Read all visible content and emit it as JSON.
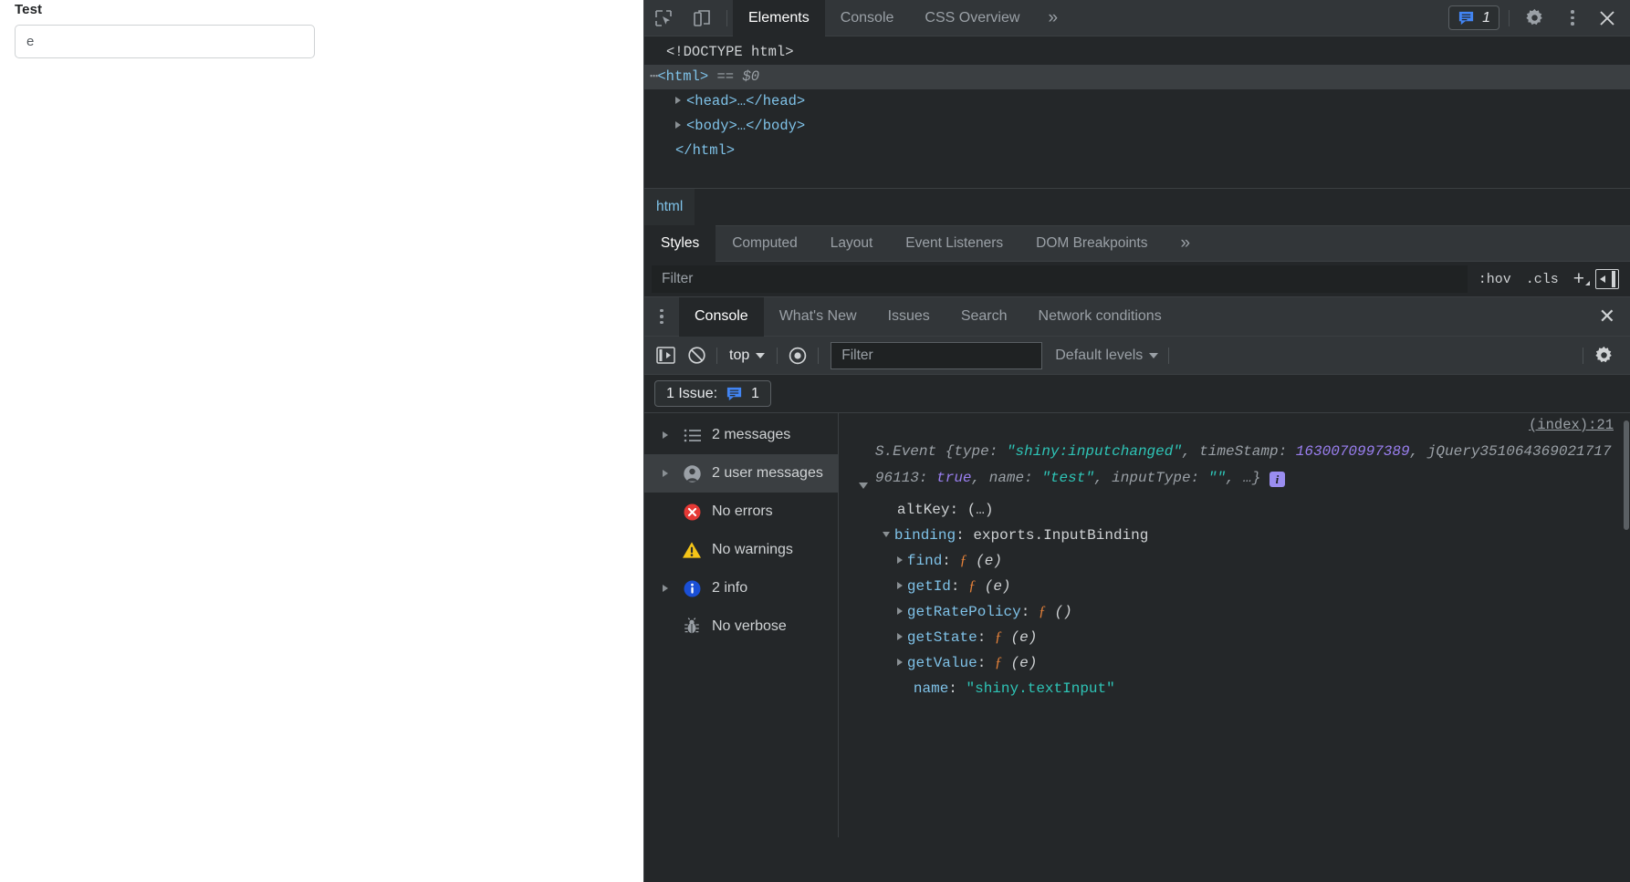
{
  "page": {
    "label": "Test",
    "input_value": "e",
    "input_placeholder": ""
  },
  "devtools": {
    "main_tabs": [
      {
        "label": "Elements",
        "active": true
      },
      {
        "label": "Console",
        "active": false
      },
      {
        "label": "CSS Overview",
        "active": false
      }
    ],
    "more_tabs_glyph": "»",
    "issue_count": "1",
    "icons": {
      "inspect": "inspect-element-icon",
      "device": "device-toolbar-icon",
      "issues": "issues-message-icon",
      "settings": "gear-icon",
      "menu": "kebab-menu-icon",
      "close": "close-icon"
    },
    "dom": {
      "doctype": "<!DOCTYPE html>",
      "html_open": "<html>",
      "eq": "==",
      "dollar0": "$0",
      "head": "<head>…</head>",
      "body": "<body>…</body>",
      "html_close": "</html>"
    },
    "breadcrumb": [
      "html"
    ],
    "styles_tabs": [
      {
        "label": "Styles",
        "active": true
      },
      {
        "label": "Computed",
        "active": false
      },
      {
        "label": "Layout",
        "active": false
      },
      {
        "label": "Event Listeners",
        "active": false
      },
      {
        "label": "DOM Breakpoints",
        "active": false
      }
    ],
    "styles_more_glyph": "»",
    "styles_filter_placeholder": "Filter",
    "styles_filter_value": "",
    "hov_label": ":hov",
    "cls_label": ".cls",
    "plus_label": "+"
  },
  "drawer": {
    "tabs": [
      {
        "label": "Console",
        "active": true
      },
      {
        "label": "What's New",
        "active": false
      },
      {
        "label": "Issues",
        "active": false
      },
      {
        "label": "Search",
        "active": false
      },
      {
        "label": "Network conditions",
        "active": false
      }
    ],
    "close_glyph": "✕",
    "toolbar": {
      "context_label": "top",
      "filter_placeholder": "Filter",
      "filter_value": "",
      "levels_label": "Default levels"
    },
    "issues_button": {
      "text": "1 Issue:",
      "count": "1"
    },
    "message_summary": [
      {
        "label": "2 messages",
        "icon": "list-icon",
        "expandable": true,
        "selected": false
      },
      {
        "label": "2 user messages",
        "icon": "user-icon",
        "expandable": true,
        "selected": true
      },
      {
        "label": "No errors",
        "icon": "error-icon",
        "expandable": false,
        "selected": false
      },
      {
        "label": "No warnings",
        "icon": "warning-icon",
        "expandable": false,
        "selected": false
      },
      {
        "label": "2 info",
        "icon": "info-icon",
        "expandable": true,
        "selected": false
      },
      {
        "label": "No verbose",
        "icon": "bug-icon",
        "expandable": false,
        "selected": false
      }
    ],
    "output": {
      "source_link": "(index):21",
      "event_header": {
        "class_name": "S.Event {",
        "k_type": "type: ",
        "v_type": "\"shiny:inputchanged\"",
        "sep1": ", ",
        "k_timestamp": "timeStamp: ",
        "v_timestamp": "1630070997389",
        "sep2": ", ",
        "k_jquery": "jQuery35106436902171796113: ",
        "v_jquery": "true",
        "sep3": ", ",
        "k_name": "name: ",
        "v_name": "\"test\"",
        "sep4": ", ",
        "k_inputtype": "inputType: ",
        "v_inputtype": "\"\"",
        "tail": ", …}",
        "info_badge": "i"
      },
      "props": [
        {
          "name": "altKey",
          "value": "(…)",
          "kind": "getter",
          "indent": 1,
          "tri": "none"
        },
        {
          "name": "binding",
          "value": "exports.InputBinding",
          "kind": "object",
          "indent": 1,
          "tri": "open"
        },
        {
          "name": "find",
          "value": "(e)",
          "kind": "function",
          "indent": 2,
          "tri": "closed"
        },
        {
          "name": "getId",
          "value": "(e)",
          "kind": "function",
          "indent": 2,
          "tri": "closed"
        },
        {
          "name": "getRatePolicy",
          "value": "()",
          "kind": "function",
          "indent": 2,
          "tri": "closed"
        },
        {
          "name": "getState",
          "value": "(e)",
          "kind": "function",
          "indent": 2,
          "tri": "closed"
        },
        {
          "name": "getValue",
          "value": "(e)",
          "kind": "function",
          "indent": 2,
          "tri": "closed"
        },
        {
          "name": "name",
          "value": "\"shiny.textInput\"",
          "kind": "string",
          "indent": 2,
          "tri": "none"
        }
      ]
    }
  },
  "colors": {
    "accent_blue": "#4285f4",
    "error_red": "#e53935",
    "warning_yellow": "#f5c518",
    "info_blue": "#1a73e8",
    "string_teal": "#2ec4b6",
    "number_purple": "#9a7ff0",
    "tag_blue": "#7fc2e8",
    "panel_bg": "#242729",
    "toolbar_bg": "#323639"
  }
}
